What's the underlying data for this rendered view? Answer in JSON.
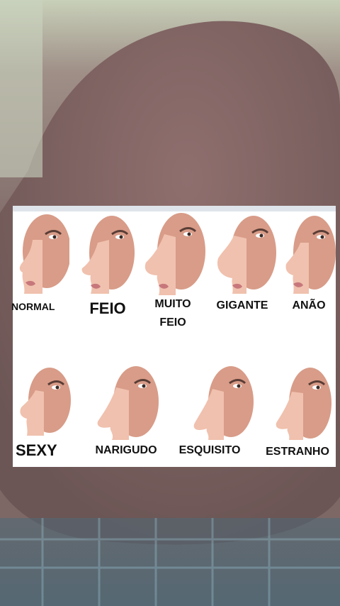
{
  "labels": {
    "normal": "NORMAL",
    "feio": "FEIO",
    "muito_feio_1": "MUITO",
    "muito_feio_2": "FEIO",
    "gigante": "GIGANTE",
    "anao": "ANÃO",
    "sexy": "SEXY",
    "narigudo": "NARIGUDO",
    "esquisito": "ESQUISITO",
    "estranho": "ESTRANHO"
  },
  "colors": {
    "skin": "#d79a86",
    "skin_dark": "#b97563",
    "skin_light": "#f0c3b0",
    "lip": "#c7777b",
    "background_skin": "#8b6f6b",
    "background_top": "#b7c2a8"
  }
}
